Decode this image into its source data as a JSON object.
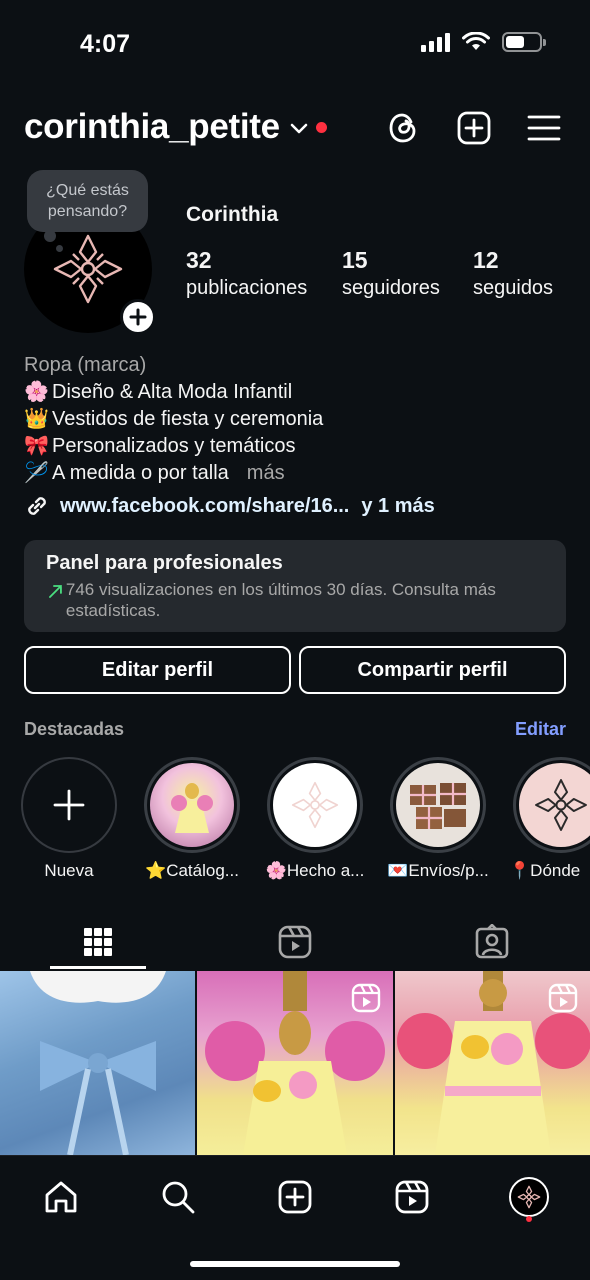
{
  "status_bar": {
    "time": "4:07",
    "battery_level": 0.55
  },
  "header": {
    "username": "corinthia_petite",
    "icons": [
      "threads-icon",
      "create-plus-icon",
      "menu-icon"
    ]
  },
  "profile": {
    "note_bubble": "¿Qué estás pensando?",
    "display_name": "Corinthia",
    "stats": [
      {
        "value": "32",
        "label": "publicaciones"
      },
      {
        "value": "15",
        "label": "seguidores"
      },
      {
        "value": "12",
        "label": "seguidos"
      }
    ]
  },
  "bio": {
    "category": "Ropa (marca)",
    "lines": [
      {
        "emoji": "🌸",
        "text": "Diseño & Alta Moda Infantil"
      },
      {
        "emoji": "👑",
        "text": "Vestidos de fiesta y ceremonia"
      },
      {
        "emoji": "🎀",
        "text": "Personalizados y temáticos"
      },
      {
        "emoji": "🪡",
        "text": "A medida o por talla"
      }
    ],
    "more": "más",
    "link": "www.facebook.com/share/16...",
    "link_more": "y 1 más"
  },
  "pro_panel": {
    "title": "Panel para profesionales",
    "description": "746 visualizaciones en los últimos 30 días. Consulta más estadísticas."
  },
  "buttons": {
    "edit": "Editar perfil",
    "share": "Compartir perfil"
  },
  "highlights": {
    "header": "Destacadas",
    "edit": "Editar",
    "items": [
      {
        "label": "Nueva"
      },
      {
        "label": "⭐Catálog..."
      },
      {
        "label": "🌸Hecho a..."
      },
      {
        "label": "💌Envíos/p..."
      },
      {
        "label": "📍Dónde"
      }
    ]
  },
  "tabs": [
    "grid-icon",
    "reels-icon",
    "tagged-icon"
  ],
  "bottom_nav": [
    "home-icon",
    "search-icon",
    "create-icon",
    "reels-icon",
    "profile-avatar"
  ]
}
